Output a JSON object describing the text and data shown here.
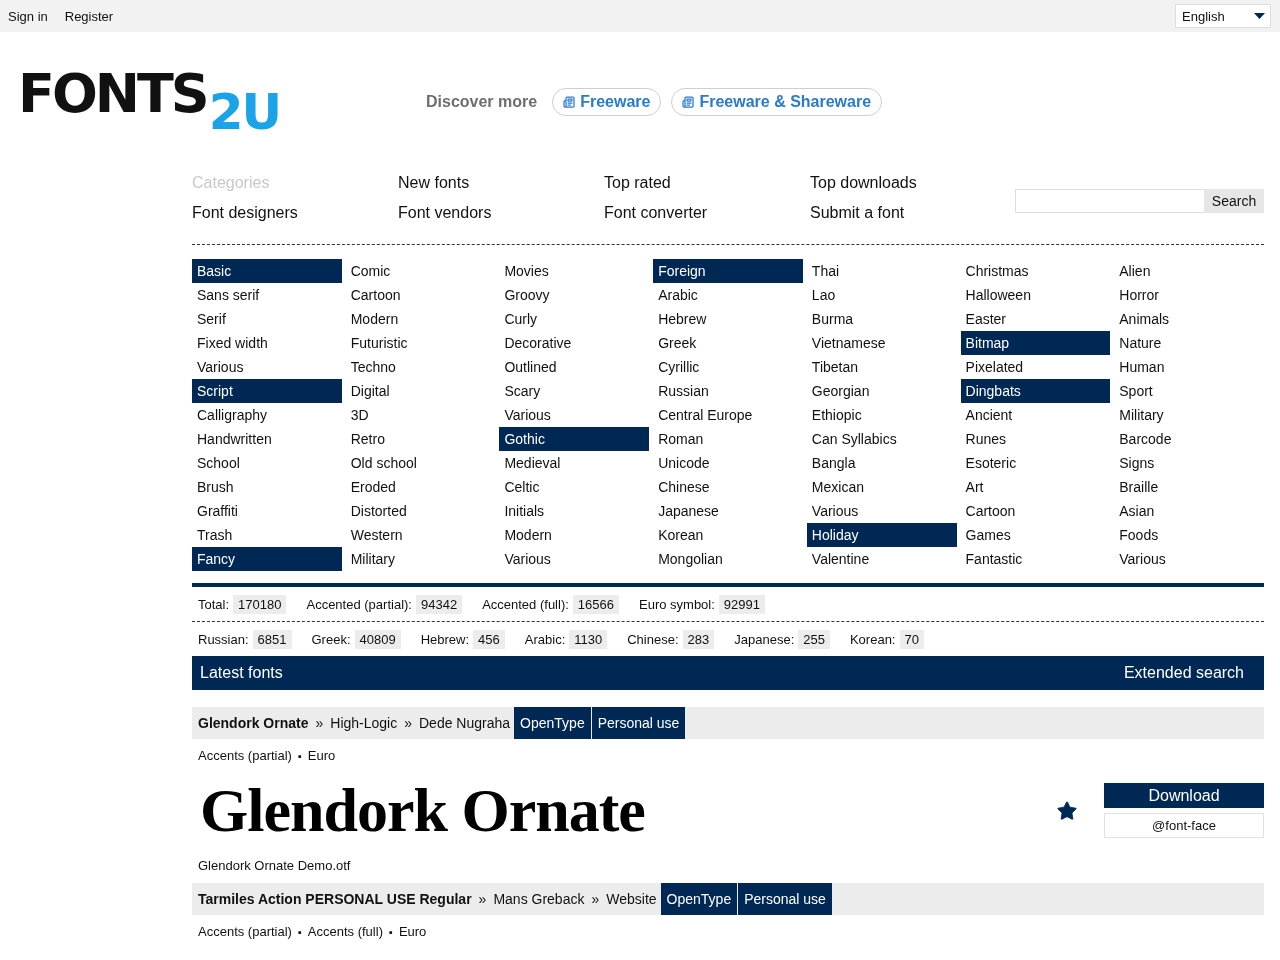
{
  "top_bar": {
    "links": [
      "Sign in",
      "Register"
    ],
    "language": {
      "value": "English"
    }
  },
  "header": {
    "logo": {
      "text": "FONTS",
      "accent": "2U"
    },
    "discover": {
      "label": "Discover more",
      "links": [
        "Freeware",
        "Freeware & Shareware"
      ]
    }
  },
  "nav": {
    "items": [
      {
        "label": "Categories",
        "selected": true
      },
      {
        "label": "New fonts",
        "selected": false
      },
      {
        "label": "Top rated",
        "selected": false
      },
      {
        "label": "Top downloads",
        "selected": false
      },
      {
        "label": "Font designers",
        "selected": false
      },
      {
        "label": "Font vendors",
        "selected": false
      },
      {
        "label": "Font converter",
        "selected": false
      },
      {
        "label": "Submit a font",
        "selected": false
      }
    ]
  },
  "search": {
    "button": "Search"
  },
  "categories": {
    "columns": [
      [
        {
          "label": "Basic",
          "kind": "group"
        },
        {
          "label": "Sans serif",
          "kind": "item"
        },
        {
          "label": "Serif",
          "kind": "item"
        },
        {
          "label": "Fixed width",
          "kind": "item"
        },
        {
          "label": "Various",
          "kind": "item"
        },
        {
          "label": "Script",
          "kind": "group"
        },
        {
          "label": "Calligraphy",
          "kind": "item"
        },
        {
          "label": "Handwritten",
          "kind": "item"
        },
        {
          "label": "School",
          "kind": "item"
        },
        {
          "label": "Brush",
          "kind": "item"
        },
        {
          "label": "Graffiti",
          "kind": "item"
        },
        {
          "label": "Trash",
          "kind": "item"
        },
        {
          "label": "Fancy",
          "kind": "group"
        }
      ],
      [
        {
          "label": "Comic",
          "kind": "item"
        },
        {
          "label": "Cartoon",
          "kind": "item"
        },
        {
          "label": "Modern",
          "kind": "item"
        },
        {
          "label": "Futuristic",
          "kind": "item"
        },
        {
          "label": "Techno",
          "kind": "item"
        },
        {
          "label": "Digital",
          "kind": "item"
        },
        {
          "label": "3D",
          "kind": "item"
        },
        {
          "label": "Retro",
          "kind": "item"
        },
        {
          "label": "Old school",
          "kind": "item"
        },
        {
          "label": "Eroded",
          "kind": "item"
        },
        {
          "label": "Distorted",
          "kind": "item"
        },
        {
          "label": "Western",
          "kind": "item"
        },
        {
          "label": "Military",
          "kind": "item"
        }
      ],
      [
        {
          "label": "Movies",
          "kind": "item"
        },
        {
          "label": "Groovy",
          "kind": "item"
        },
        {
          "label": "Curly",
          "kind": "item"
        },
        {
          "label": "Decorative",
          "kind": "item"
        },
        {
          "label": "Outlined",
          "kind": "item"
        },
        {
          "label": "Scary",
          "kind": "item"
        },
        {
          "label": "Various",
          "kind": "item"
        },
        {
          "label": "Gothic",
          "kind": "group"
        },
        {
          "label": "Medieval",
          "kind": "item"
        },
        {
          "label": "Celtic",
          "kind": "item"
        },
        {
          "label": "Initials",
          "kind": "item"
        },
        {
          "label": "Modern",
          "kind": "item"
        },
        {
          "label": "Various",
          "kind": "item"
        }
      ],
      [
        {
          "label": "Foreign",
          "kind": "group"
        },
        {
          "label": "Arabic",
          "kind": "item"
        },
        {
          "label": "Hebrew",
          "kind": "item"
        },
        {
          "label": "Greek",
          "kind": "item"
        },
        {
          "label": "Cyrillic",
          "kind": "item"
        },
        {
          "label": "Russian",
          "kind": "item"
        },
        {
          "label": "Central Europe",
          "kind": "item"
        },
        {
          "label": "Roman",
          "kind": "item"
        },
        {
          "label": "Unicode",
          "kind": "item"
        },
        {
          "label": "Chinese",
          "kind": "item"
        },
        {
          "label": "Japanese",
          "kind": "item"
        },
        {
          "label": "Korean",
          "kind": "item"
        },
        {
          "label": "Mongolian",
          "kind": "item"
        }
      ],
      [
        {
          "label": "Thai",
          "kind": "item"
        },
        {
          "label": "Lao",
          "kind": "item"
        },
        {
          "label": "Burma",
          "kind": "item"
        },
        {
          "label": "Vietnamese",
          "kind": "item"
        },
        {
          "label": "Tibetan",
          "kind": "item"
        },
        {
          "label": "Georgian",
          "kind": "item"
        },
        {
          "label": "Ethiopic",
          "kind": "item"
        },
        {
          "label": "Can Syllabics",
          "kind": "item"
        },
        {
          "label": "Bangla",
          "kind": "item"
        },
        {
          "label": "Mexican",
          "kind": "item"
        },
        {
          "label": "Various",
          "kind": "item"
        },
        {
          "label": "Holiday",
          "kind": "group"
        },
        {
          "label": "Valentine",
          "kind": "item"
        }
      ],
      [
        {
          "label": "Christmas",
          "kind": "item"
        },
        {
          "label": "Halloween",
          "kind": "item"
        },
        {
          "label": "Easter",
          "kind": "item"
        },
        {
          "label": "Bitmap",
          "kind": "group"
        },
        {
          "label": "Pixelated",
          "kind": "item"
        },
        {
          "label": "Dingbats",
          "kind": "group"
        },
        {
          "label": "Ancient",
          "kind": "item"
        },
        {
          "label": "Runes",
          "kind": "item"
        },
        {
          "label": "Esoteric",
          "kind": "item"
        },
        {
          "label": "Art",
          "kind": "item"
        },
        {
          "label": "Cartoon",
          "kind": "item"
        },
        {
          "label": "Games",
          "kind": "item"
        },
        {
          "label": "Fantastic",
          "kind": "item"
        }
      ],
      [
        {
          "label": "Alien",
          "kind": "item"
        },
        {
          "label": "Horror",
          "kind": "item"
        },
        {
          "label": "Animals",
          "kind": "item"
        },
        {
          "label": "Nature",
          "kind": "item"
        },
        {
          "label": "Human",
          "kind": "item"
        },
        {
          "label": "Sport",
          "kind": "item"
        },
        {
          "label": "Military",
          "kind": "item"
        },
        {
          "label": "Barcode",
          "kind": "item"
        },
        {
          "label": "Signs",
          "kind": "item"
        },
        {
          "label": "Braille",
          "kind": "item"
        },
        {
          "label": "Asian",
          "kind": "item"
        },
        {
          "label": "Foods",
          "kind": "item"
        },
        {
          "label": "Various",
          "kind": "item"
        }
      ]
    ]
  },
  "stats": {
    "totals": [
      {
        "label": "Total:",
        "value": "170180"
      },
      {
        "label": "Accented (partial):",
        "value": "94342"
      },
      {
        "label": "Accented (full):",
        "value": "16566"
      },
      {
        "label": "Euro symbol:",
        "value": "92991"
      }
    ],
    "scripts": [
      {
        "label": "Russian:",
        "value": "6851"
      },
      {
        "label": "Greek:",
        "value": "40809"
      },
      {
        "label": "Hebrew:",
        "value": "456"
      },
      {
        "label": "Arabic:",
        "value": "1130"
      },
      {
        "label": "Chinese:",
        "value": "283"
      },
      {
        "label": "Japanese:",
        "value": "255"
      },
      {
        "label": "Korean:",
        "value": "70"
      }
    ]
  },
  "latest": {
    "title": "Latest fonts",
    "link": "Extended search"
  },
  "fonts": [
    {
      "name": "Glendork Ornate",
      "separator": "»",
      "path": [
        "High-Logic",
        "Dede Nugraha"
      ],
      "tags": [
        "OpenType",
        "Personal use"
      ],
      "bullet": "▪",
      "features": [
        "Accents (partial)",
        "Euro"
      ],
      "preview": "Glendork Ornate",
      "download": "Download",
      "embed": "@font-face",
      "file": "Glendork Ornate Demo.otf"
    },
    {
      "name": "Tarmiles Action PERSONAL USE Regular",
      "separator": "»",
      "path": [
        "Mans Greback",
        "Website"
      ],
      "tags": [
        "OpenType",
        "Personal use"
      ],
      "bullet": "▪",
      "features": [
        "Accents (partial)",
        "Accents (full)",
        "Euro"
      ]
    }
  ]
}
